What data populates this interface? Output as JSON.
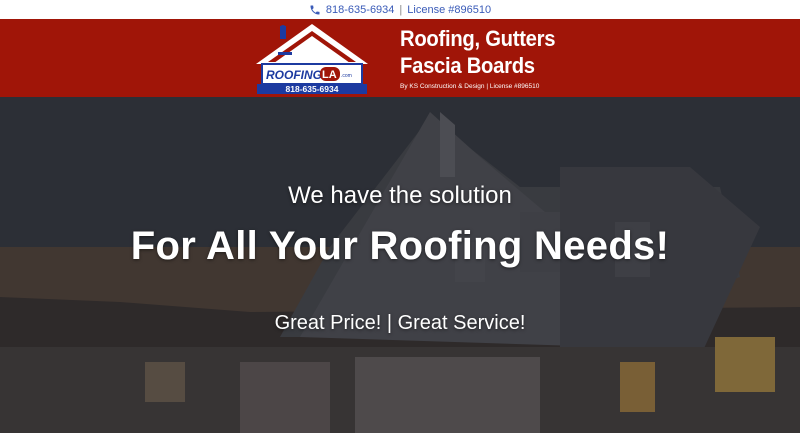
{
  "topbar": {
    "phone": "818-635-6934",
    "separator": "|",
    "license": "License #896510"
  },
  "logo": {
    "brand_left": "ROOFING",
    "brand_right": "LA",
    "brand_suffix": ".com",
    "phone": "818-635-6934"
  },
  "tagline": {
    "line1": "Roofing, Gutters",
    "line2": "Fascia Boards",
    "sub": "By KS Construction & Design | License #896510"
  },
  "hero": {
    "subtitle": "We have the solution",
    "title": "For All Your Roofing Needs!",
    "tagline": "Great Price! | Great Service!"
  },
  "colors": {
    "header_red": "#a01508",
    "link_blue": "#3a5bb8",
    "logo_blue": "#1c3aa0"
  }
}
